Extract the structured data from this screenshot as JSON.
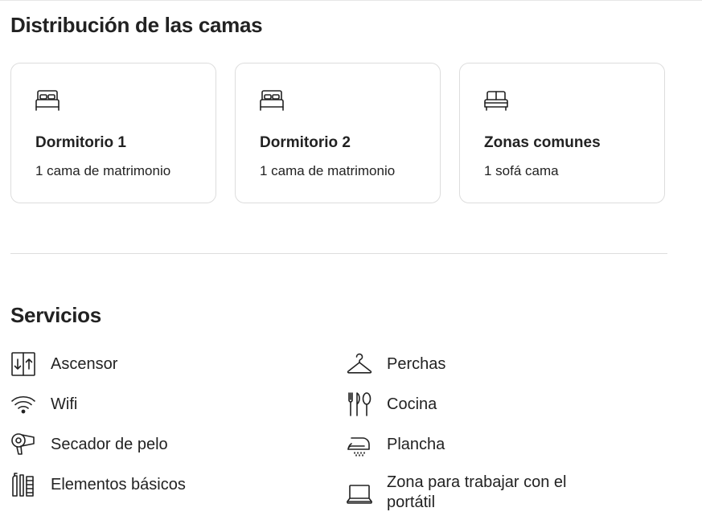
{
  "beds": {
    "title": "Distribución de las camas",
    "rooms": [
      {
        "name": "Dormitorio 1",
        "desc": "1 cama de matrimonio",
        "icon": "double-bed-icon"
      },
      {
        "name": "Dormitorio 2",
        "desc": "1 cama de matrimonio",
        "icon": "double-bed-icon"
      },
      {
        "name": "Zonas comunes",
        "desc": "1 sofá cama",
        "icon": "sofa-bed-icon"
      }
    ]
  },
  "services": {
    "title": "Servicios",
    "items": [
      {
        "label": "Ascensor",
        "icon": "elevator-icon"
      },
      {
        "label": "Perchas",
        "icon": "hanger-icon"
      },
      {
        "label": "Wifi",
        "icon": "wifi-icon"
      },
      {
        "label": "Cocina",
        "icon": "kitchen-utensils-icon"
      },
      {
        "label": "Secador de pelo",
        "icon": "hair-dryer-icon"
      },
      {
        "label": "Plancha",
        "icon": "iron-icon"
      },
      {
        "label": "Elementos básicos",
        "icon": "toiletries-icon"
      },
      {
        "label": "Zona para trabajar con el portátil",
        "icon": "laptop-workspace-icon"
      }
    ]
  }
}
